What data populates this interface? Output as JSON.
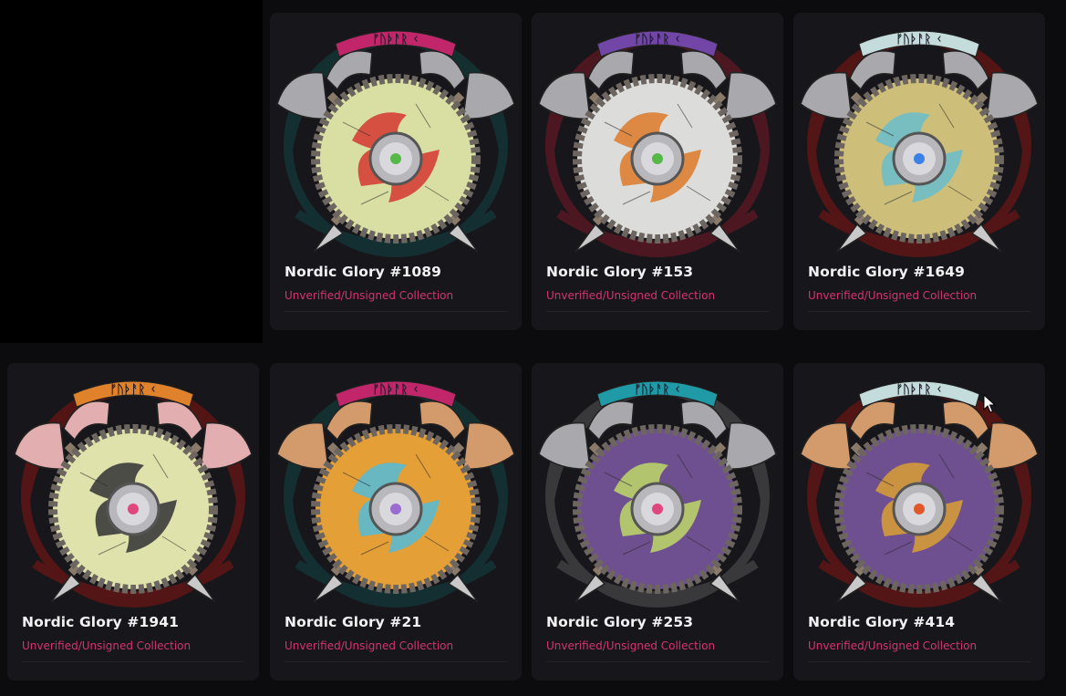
{
  "cards": [
    {
      "title": "Nordic Glory #1089",
      "subtitle": "Unverified/Unsigned Collection",
      "colors": {
        "bg": "#143234",
        "band": "#c2266a",
        "face": "#d9dfa2",
        "motif": "#d54036",
        "axe": "#a9a9ad",
        "gem": "#56b848"
      }
    },
    {
      "title": "Nordic Glory #153",
      "subtitle": "Unverified/Unsigned Collection",
      "colors": {
        "bg": "#531822",
        "band": "#7146a6",
        "face": "#dcdcda",
        "motif": "#dd7e32",
        "axe": "#a9a9ad",
        "gem": "#56b848"
      }
    },
    {
      "title": "Nordic Glory #1649",
      "subtitle": "Unverified/Unsigned Collection",
      "colors": {
        "bg": "#5a1515",
        "band": "#c5dcdc",
        "face": "#cdbf7a",
        "motif": "#6fbcc6",
        "axe": "#a9a9ad",
        "gem": "#3b82e6"
      }
    },
    {
      "title": "Nordic Glory #1941",
      "subtitle": "Unverified/Unsigned Collection",
      "colors": {
        "bg": "#5a1515",
        "band": "#e0812c",
        "face": "#dfe2ab",
        "motif": "#3c3c3c",
        "axe": "#e2aeb0",
        "gem": "#e0487d"
      }
    },
    {
      "title": "Nordic Glory #21",
      "subtitle": "Unverified/Unsigned Collection",
      "colors": {
        "bg": "#143234",
        "band": "#c2266a",
        "face": "#e49f36",
        "motif": "#5bb9d0",
        "axe": "#d39b6c",
        "gem": "#9a6bd1"
      }
    },
    {
      "title": "Nordic Glory #253",
      "subtitle": "Unverified/Unsigned Collection",
      "colors": {
        "bg": "#3d3d40",
        "band": "#1f9aa6",
        "face": "#6e4f8f",
        "motif": "#b9d06a",
        "axe": "#a9a9ad",
        "gem": "#e0487d"
      }
    },
    {
      "title": "Nordic Glory #414",
      "subtitle": "Unverified/Unsigned Collection",
      "colors": {
        "bg": "#5a1515",
        "band": "#c5dcdc",
        "face": "#6e4f8f",
        "motif": "#d49a3a",
        "axe": "#d39b6c",
        "gem": "#e0582a"
      }
    }
  ],
  "band_runes": "ᚠᚢᚦᚨᚱ ᚲ",
  "icons": {
    "cursor": "mouse-pointer-icon"
  }
}
